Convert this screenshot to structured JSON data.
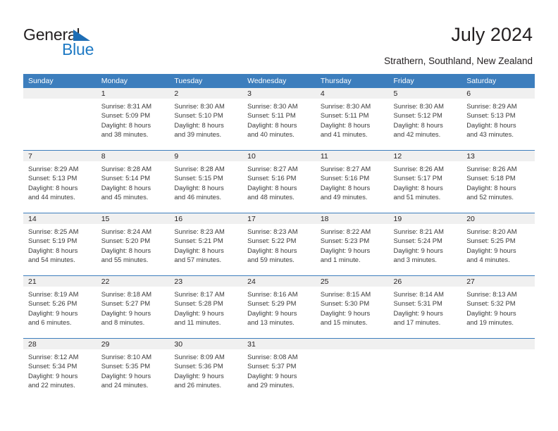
{
  "logo": {
    "word1": "General",
    "word2": "Blue",
    "triangle_color": "#1f6eb5",
    "blue_color": "#1f7ac4"
  },
  "header": {
    "title": "July 2024",
    "subtitle": "Strathern, Southland, New Zealand"
  },
  "theme": {
    "header_bg": "#3d7ebd",
    "daynum_bg": "#f0f0f0",
    "row_divider": "#3d7ebd",
    "text": "#231f20",
    "detail_text": "#3a3a3a"
  },
  "weekday_headers": [
    "Sunday",
    "Monday",
    "Tuesday",
    "Wednesday",
    "Thursday",
    "Friday",
    "Saturday"
  ],
  "weeks": [
    [
      {
        "day": "",
        "sunrise": "",
        "sunset": "",
        "daylight1": "",
        "daylight2": ""
      },
      {
        "day": "1",
        "sunrise": "Sunrise: 8:31 AM",
        "sunset": "Sunset: 5:09 PM",
        "daylight1": "Daylight: 8 hours",
        "daylight2": "and 38 minutes."
      },
      {
        "day": "2",
        "sunrise": "Sunrise: 8:30 AM",
        "sunset": "Sunset: 5:10 PM",
        "daylight1": "Daylight: 8 hours",
        "daylight2": "and 39 minutes."
      },
      {
        "day": "3",
        "sunrise": "Sunrise: 8:30 AM",
        "sunset": "Sunset: 5:11 PM",
        "daylight1": "Daylight: 8 hours",
        "daylight2": "and 40 minutes."
      },
      {
        "day": "4",
        "sunrise": "Sunrise: 8:30 AM",
        "sunset": "Sunset: 5:11 PM",
        "daylight1": "Daylight: 8 hours",
        "daylight2": "and 41 minutes."
      },
      {
        "day": "5",
        "sunrise": "Sunrise: 8:30 AM",
        "sunset": "Sunset: 5:12 PM",
        "daylight1": "Daylight: 8 hours",
        "daylight2": "and 42 minutes."
      },
      {
        "day": "6",
        "sunrise": "Sunrise: 8:29 AM",
        "sunset": "Sunset: 5:13 PM",
        "daylight1": "Daylight: 8 hours",
        "daylight2": "and 43 minutes."
      }
    ],
    [
      {
        "day": "7",
        "sunrise": "Sunrise: 8:29 AM",
        "sunset": "Sunset: 5:13 PM",
        "daylight1": "Daylight: 8 hours",
        "daylight2": "and 44 minutes."
      },
      {
        "day": "8",
        "sunrise": "Sunrise: 8:28 AM",
        "sunset": "Sunset: 5:14 PM",
        "daylight1": "Daylight: 8 hours",
        "daylight2": "and 45 minutes."
      },
      {
        "day": "9",
        "sunrise": "Sunrise: 8:28 AM",
        "sunset": "Sunset: 5:15 PM",
        "daylight1": "Daylight: 8 hours",
        "daylight2": "and 46 minutes."
      },
      {
        "day": "10",
        "sunrise": "Sunrise: 8:27 AM",
        "sunset": "Sunset: 5:16 PM",
        "daylight1": "Daylight: 8 hours",
        "daylight2": "and 48 minutes."
      },
      {
        "day": "11",
        "sunrise": "Sunrise: 8:27 AM",
        "sunset": "Sunset: 5:16 PM",
        "daylight1": "Daylight: 8 hours",
        "daylight2": "and 49 minutes."
      },
      {
        "day": "12",
        "sunrise": "Sunrise: 8:26 AM",
        "sunset": "Sunset: 5:17 PM",
        "daylight1": "Daylight: 8 hours",
        "daylight2": "and 51 minutes."
      },
      {
        "day": "13",
        "sunrise": "Sunrise: 8:26 AM",
        "sunset": "Sunset: 5:18 PM",
        "daylight1": "Daylight: 8 hours",
        "daylight2": "and 52 minutes."
      }
    ],
    [
      {
        "day": "14",
        "sunrise": "Sunrise: 8:25 AM",
        "sunset": "Sunset: 5:19 PM",
        "daylight1": "Daylight: 8 hours",
        "daylight2": "and 54 minutes."
      },
      {
        "day": "15",
        "sunrise": "Sunrise: 8:24 AM",
        "sunset": "Sunset: 5:20 PM",
        "daylight1": "Daylight: 8 hours",
        "daylight2": "and 55 minutes."
      },
      {
        "day": "16",
        "sunrise": "Sunrise: 8:23 AM",
        "sunset": "Sunset: 5:21 PM",
        "daylight1": "Daylight: 8 hours",
        "daylight2": "and 57 minutes."
      },
      {
        "day": "17",
        "sunrise": "Sunrise: 8:23 AM",
        "sunset": "Sunset: 5:22 PM",
        "daylight1": "Daylight: 8 hours",
        "daylight2": "and 59 minutes."
      },
      {
        "day": "18",
        "sunrise": "Sunrise: 8:22 AM",
        "sunset": "Sunset: 5:23 PM",
        "daylight1": "Daylight: 9 hours",
        "daylight2": "and 1 minute."
      },
      {
        "day": "19",
        "sunrise": "Sunrise: 8:21 AM",
        "sunset": "Sunset: 5:24 PM",
        "daylight1": "Daylight: 9 hours",
        "daylight2": "and 3 minutes."
      },
      {
        "day": "20",
        "sunrise": "Sunrise: 8:20 AM",
        "sunset": "Sunset: 5:25 PM",
        "daylight1": "Daylight: 9 hours",
        "daylight2": "and 4 minutes."
      }
    ],
    [
      {
        "day": "21",
        "sunrise": "Sunrise: 8:19 AM",
        "sunset": "Sunset: 5:26 PM",
        "daylight1": "Daylight: 9 hours",
        "daylight2": "and 6 minutes."
      },
      {
        "day": "22",
        "sunrise": "Sunrise: 8:18 AM",
        "sunset": "Sunset: 5:27 PM",
        "daylight1": "Daylight: 9 hours",
        "daylight2": "and 8 minutes."
      },
      {
        "day": "23",
        "sunrise": "Sunrise: 8:17 AM",
        "sunset": "Sunset: 5:28 PM",
        "daylight1": "Daylight: 9 hours",
        "daylight2": "and 11 minutes."
      },
      {
        "day": "24",
        "sunrise": "Sunrise: 8:16 AM",
        "sunset": "Sunset: 5:29 PM",
        "daylight1": "Daylight: 9 hours",
        "daylight2": "and 13 minutes."
      },
      {
        "day": "25",
        "sunrise": "Sunrise: 8:15 AM",
        "sunset": "Sunset: 5:30 PM",
        "daylight1": "Daylight: 9 hours",
        "daylight2": "and 15 minutes."
      },
      {
        "day": "26",
        "sunrise": "Sunrise: 8:14 AM",
        "sunset": "Sunset: 5:31 PM",
        "daylight1": "Daylight: 9 hours",
        "daylight2": "and 17 minutes."
      },
      {
        "day": "27",
        "sunrise": "Sunrise: 8:13 AM",
        "sunset": "Sunset: 5:32 PM",
        "daylight1": "Daylight: 9 hours",
        "daylight2": "and 19 minutes."
      }
    ],
    [
      {
        "day": "28",
        "sunrise": "Sunrise: 8:12 AM",
        "sunset": "Sunset: 5:34 PM",
        "daylight1": "Daylight: 9 hours",
        "daylight2": "and 22 minutes."
      },
      {
        "day": "29",
        "sunrise": "Sunrise: 8:10 AM",
        "sunset": "Sunset: 5:35 PM",
        "daylight1": "Daylight: 9 hours",
        "daylight2": "and 24 minutes."
      },
      {
        "day": "30",
        "sunrise": "Sunrise: 8:09 AM",
        "sunset": "Sunset: 5:36 PM",
        "daylight1": "Daylight: 9 hours",
        "daylight2": "and 26 minutes."
      },
      {
        "day": "31",
        "sunrise": "Sunrise: 8:08 AM",
        "sunset": "Sunset: 5:37 PM",
        "daylight1": "Daylight: 9 hours",
        "daylight2": "and 29 minutes."
      },
      {
        "day": "",
        "sunrise": "",
        "sunset": "",
        "daylight1": "",
        "daylight2": ""
      },
      {
        "day": "",
        "sunrise": "",
        "sunset": "",
        "daylight1": "",
        "daylight2": ""
      },
      {
        "day": "",
        "sunrise": "",
        "sunset": "",
        "daylight1": "",
        "daylight2": ""
      }
    ]
  ]
}
